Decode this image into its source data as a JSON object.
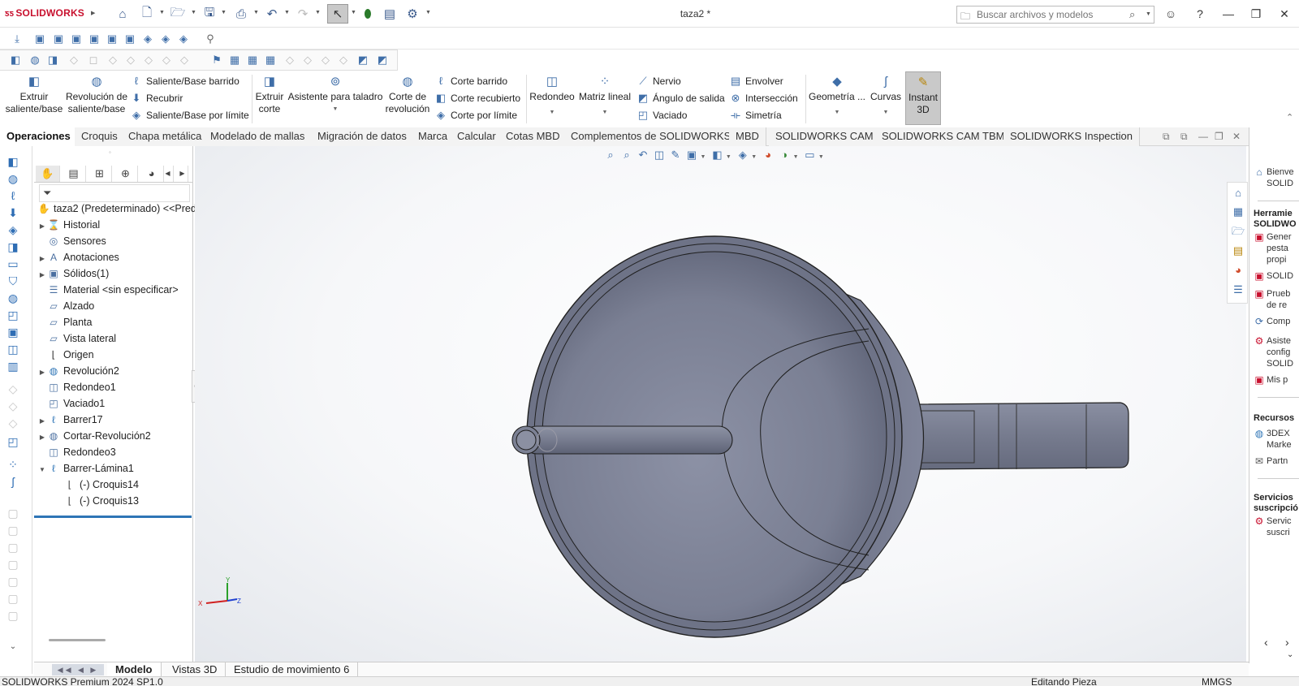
{
  "app": {
    "logo": "SOLIDWORKS",
    "doc_title": "taza2 *"
  },
  "search": {
    "placeholder": "Buscar archivos y modelos"
  },
  "commands": {
    "extrude": "Extruir saliente/base",
    "revolve": "Revolución de saliente/base",
    "swept_boss": "Saliente/Base barrido",
    "loft": "Recubrir",
    "boundary_boss": "Saliente/Base por límite",
    "extruded_cut": "Extruir corte",
    "hole_wizard": "Asistente para taladro",
    "revolved_cut": "Corte de revolución",
    "swept_cut": "Corte barrido",
    "lofted_cut": "Corte recubierto",
    "boundary_cut": "Corte por límite",
    "fillet": "Redondeo",
    "linear_pattern": "Matriz lineal",
    "rib": "Nervio",
    "draft": "Ángulo de salida",
    "shell": "Vaciado",
    "wrap": "Envolver",
    "intersect": "Intersección",
    "mirror": "Simetría",
    "ref_geometry": "Geometría ...",
    "curves": "Curvas",
    "instant3d": "Instant 3D"
  },
  "tabs": [
    "Operaciones",
    "Croquis",
    "Chapa metálica",
    "Modelado de mallas",
    "Migración de datos",
    "Marca",
    "Calcular",
    "Cotas MBD",
    "Complementos de SOLIDWORKS",
    "MBD",
    "SOLIDWORKS CAM",
    "SOLIDWORKS CAM TBM",
    "SOLIDWORKS Inspection"
  ],
  "tree": {
    "root": "taza2 (Predeterminado) <<Prede",
    "items": [
      "Historial",
      "Sensores",
      "Anotaciones",
      "Sólidos(1)",
      "Material <sin especificar>",
      "Alzado",
      "Planta",
      "Vista lateral",
      "Origen",
      "Revolución2",
      "Redondeo1",
      "Vaciado1",
      "Barrer17",
      "Cortar-Revolución2",
      "Redondeo3",
      "Barrer-Lámina1",
      "(-) Croquis14",
      "(-) Croquis13"
    ]
  },
  "triad": {
    "x": "X",
    "y": "Y",
    "z": "Z"
  },
  "task_pane": {
    "welcome": [
      "Bienve",
      "SOLID"
    ],
    "tools_head": [
      "Herramie",
      "SOLIDWO"
    ],
    "tools": [
      [
        "Gener",
        "pesta",
        "propi"
      ],
      [
        "SOLID"
      ],
      [
        "Prueb",
        "de re"
      ],
      [
        "Comp"
      ],
      [
        "Asiste",
        "config",
        "SOLID"
      ],
      [
        "Mis p"
      ]
    ],
    "resources_head": "Recursos",
    "resources": [
      [
        "3DEX",
        "Marke"
      ],
      [
        "Partn"
      ]
    ],
    "services_head": [
      "Servicios",
      "suscripció"
    ],
    "services": [
      [
        "Servic",
        "suscri"
      ]
    ]
  },
  "bottom_tabs": [
    "Modelo",
    "Vistas 3D",
    "Estudio de movimiento 6"
  ],
  "status": {
    "product": "SOLIDWORKS Premium 2024 SP1.0",
    "mode": "Editando Pieza",
    "units": "MMGS"
  },
  "colors": {
    "brand": "#c8102e",
    "accent": "#2e75b6",
    "part": "#6f7486"
  }
}
